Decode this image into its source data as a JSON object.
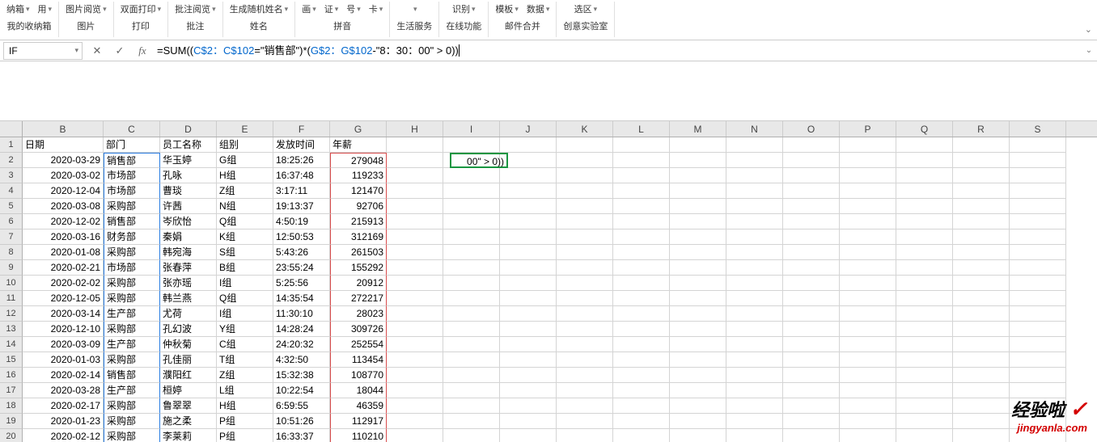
{
  "ribbon": {
    "groups": [
      {
        "row1": [
          "纳箱",
          "用"
        ],
        "row2": "我的收纳箱"
      },
      {
        "row1": [
          "图片阅览"
        ],
        "row2": "图片"
      },
      {
        "row1": [
          "双面打印"
        ],
        "row2": "打印"
      },
      {
        "row1": [
          "批注阅览"
        ],
        "row2": "批注"
      },
      {
        "row1": [
          "生成随机姓名"
        ],
        "row2": "姓名"
      },
      {
        "row1": [
          "画",
          "证",
          "号",
          "卡"
        ],
        "row2": "拼音"
      },
      {
        "row1": [
          ""
        ],
        "row2": "生活服务"
      },
      {
        "row1": [
          "识别"
        ],
        "row2": "在线功能"
      },
      {
        "row1": [
          "模板",
          "数据"
        ],
        "row2": "邮件合并"
      },
      {
        "row1": [
          "选区"
        ],
        "row2": "创意实验室"
      }
    ]
  },
  "formula_bar": {
    "name_box": "IF",
    "cancel": "✕",
    "confirm": "✓",
    "fx": "fx",
    "formula_prefix": "=SUM((",
    "formula_ref1": "C$2：C$102",
    "formula_mid1": "=\"销售部\")*(",
    "formula_ref2": "G$2：G$102",
    "formula_mid2": "-\"8：30：00\" > 0))",
    "expand": "⌄"
  },
  "columns": [
    "B",
    "C",
    "D",
    "E",
    "F",
    "G",
    "H",
    "I",
    "J",
    "K",
    "L",
    "M",
    "N",
    "O",
    "P",
    "Q",
    "R",
    "S"
  ],
  "headers": {
    "B": "日期",
    "C": "部门",
    "D": "员工名称",
    "E": "组别",
    "F": "发放时间",
    "G": "年薪"
  },
  "active_cell_overflow": "00\" > 0))",
  "rows": [
    {
      "n": 1,
      "B": "日期",
      "C": "部门",
      "D": "员工名称",
      "E": "组别",
      "F": "发放时间",
      "G": "年薪"
    },
    {
      "n": 2,
      "B": "2020-03-29",
      "C": "销售部",
      "D": "华玉婷",
      "E": "G组",
      "F": "18:25:26",
      "G": "279048"
    },
    {
      "n": 3,
      "B": "2020-03-02",
      "C": "市场部",
      "D": "孔咏",
      "E": "H组",
      "F": "16:37:48",
      "G": "119233"
    },
    {
      "n": 4,
      "B": "2020-12-04",
      "C": "市场部",
      "D": "曹琰",
      "E": "Z组",
      "F": "3:17:11",
      "G": "121470"
    },
    {
      "n": 5,
      "B": "2020-03-08",
      "C": "采购部",
      "D": "许茜",
      "E": "N组",
      "F": "19:13:37",
      "G": "92706"
    },
    {
      "n": 6,
      "B": "2020-12-02",
      "C": "销售部",
      "D": "岑欣怡",
      "E": "Q组",
      "F": "4:50:19",
      "G": "215913"
    },
    {
      "n": 7,
      "B": "2020-03-16",
      "C": "财务部",
      "D": "秦娟",
      "E": "K组",
      "F": "12:50:53",
      "G": "312169"
    },
    {
      "n": 8,
      "B": "2020-01-08",
      "C": "采购部",
      "D": "韩宛海",
      "E": "S组",
      "F": "5:43:26",
      "G": "261503"
    },
    {
      "n": 9,
      "B": "2020-02-21",
      "C": "市场部",
      "D": "张春萍",
      "E": "B组",
      "F": "23:55:24",
      "G": "155292"
    },
    {
      "n": 10,
      "B": "2020-02-02",
      "C": "采购部",
      "D": "张亦瑶",
      "E": "I组",
      "F": "5:25:56",
      "G": "20912"
    },
    {
      "n": 11,
      "B": "2020-12-05",
      "C": "采购部",
      "D": "韩兰燕",
      "E": "Q组",
      "F": "14:35:54",
      "G": "272217"
    },
    {
      "n": 12,
      "B": "2020-03-14",
      "C": "生产部",
      "D": "尤荷",
      "E": "I组",
      "F": "11:30:10",
      "G": "28023"
    },
    {
      "n": 13,
      "B": "2020-12-10",
      "C": "采购部",
      "D": "孔幻波",
      "E": "Y组",
      "F": "14:28:24",
      "G": "309726"
    },
    {
      "n": 14,
      "B": "2020-03-09",
      "C": "生产部",
      "D": "仲秋菊",
      "E": "C组",
      "F": "24:20:32",
      "G": "252554"
    },
    {
      "n": 15,
      "B": "2020-01-03",
      "C": "采购部",
      "D": "孔佳丽",
      "E": "T组",
      "F": "4:32:50",
      "G": "113454"
    },
    {
      "n": 16,
      "B": "2020-02-14",
      "C": "销售部",
      "D": "濮阳红",
      "E": "Z组",
      "F": "15:32:38",
      "G": "108770"
    },
    {
      "n": 17,
      "B": "2020-03-28",
      "C": "生产部",
      "D": "桓婷",
      "E": "L组",
      "F": "10:22:54",
      "G": "18044"
    },
    {
      "n": 18,
      "B": "2020-02-17",
      "C": "采购部",
      "D": "鲁翠翠",
      "E": "H组",
      "F": "6:59:55",
      "G": "46359"
    },
    {
      "n": 19,
      "B": "2020-01-23",
      "C": "采购部",
      "D": "施之柔",
      "E": "P组",
      "F": "10:51:26",
      "G": "112917"
    },
    {
      "n": 20,
      "B": "2020-02-12",
      "C": "采购部",
      "D": "李莱莉",
      "E": "P组",
      "F": "16:33:37",
      "G": "110210"
    }
  ],
  "watermark": {
    "line1": "经验啦",
    "check": "✓",
    "line2": "jingyanla.com"
  }
}
